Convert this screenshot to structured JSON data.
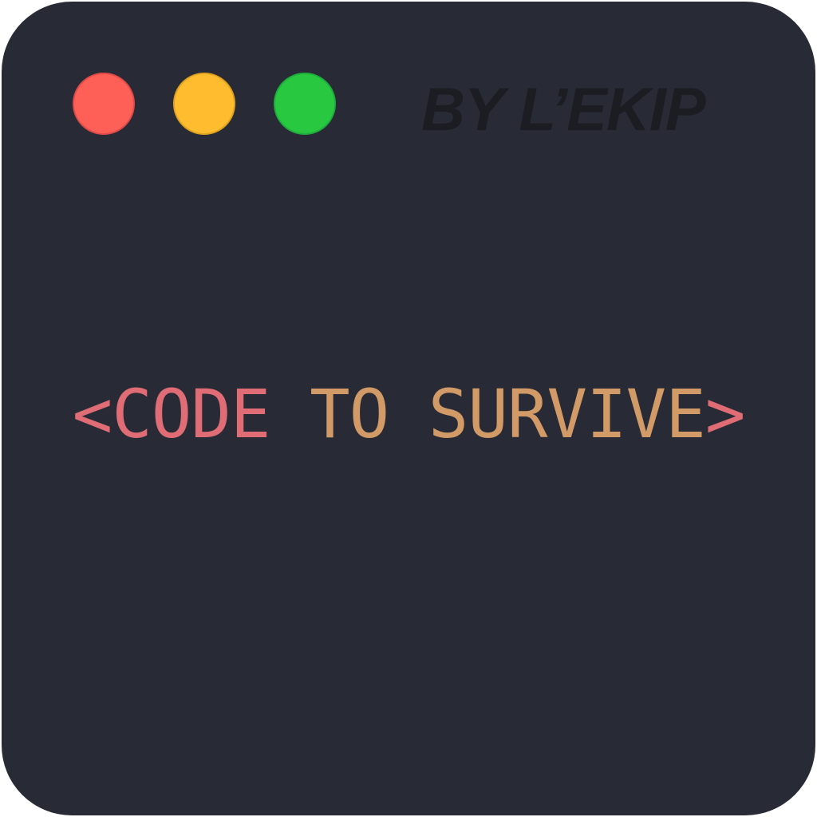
{
  "window": {
    "background": "#282b35",
    "controls": [
      {
        "name": "close",
        "color": "#fe5f57"
      },
      {
        "name": "minimize",
        "color": "#febc2e"
      },
      {
        "name": "maximize",
        "color": "#28c840"
      }
    ]
  },
  "brand": {
    "text": "BY L’EKIP",
    "color": "#1b1d23"
  },
  "tagline": {
    "open_bracket": "<",
    "word1": "CODE",
    "space1": " ",
    "word2": "TO",
    "space2": " ",
    "word3": "SURVIVE",
    "close_bracket": ">",
    "bracket_color": "#e06c75",
    "tag_color": "#e06c75",
    "attr_color": "#d19a66"
  }
}
